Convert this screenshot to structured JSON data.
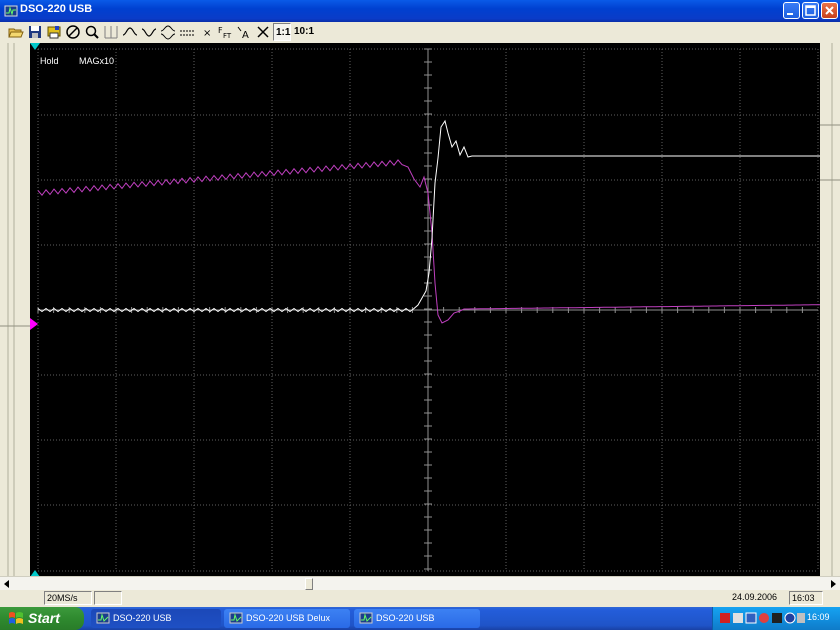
{
  "window": {
    "title": "DSO-220 USB"
  },
  "toolbar": {
    "buttons": [
      {
        "name": "open-folder-icon"
      },
      {
        "name": "save-disk-icon"
      },
      {
        "name": "print-icon"
      },
      {
        "name": "stop-icon"
      },
      {
        "name": "zoom-icon"
      },
      {
        "name": "grid-icon"
      },
      {
        "name": "wave-sine-icon"
      },
      {
        "name": "wave-invert-icon"
      },
      {
        "name": "wave-dual-icon"
      },
      {
        "name": "dotted-line-icon"
      },
      {
        "name": "marker-icon"
      },
      {
        "name": "fft-icon"
      },
      {
        "name": "auto-icon"
      },
      {
        "name": "cursor-icon"
      }
    ],
    "ratio_1_1": "1:1",
    "ratio_10_1": "10:1"
  },
  "scope": {
    "hold_label": "Hold",
    "mag_label": "MAGx10",
    "colors": {
      "ch1": "#ffffff",
      "ch2": "#c040c0",
      "grid": "#606060",
      "marker": "#ff00ff",
      "trigger": "#00c8c8"
    }
  },
  "status": {
    "rate": "20MS/s",
    "date": "24.09.2006",
    "time": "16:03"
  },
  "taskbar": {
    "start": "Start",
    "tasks": [
      {
        "label": "DSO-220 USB",
        "active": true
      },
      {
        "label": "DSO-220 USB Delux",
        "active": false
      },
      {
        "label": "DSO-220 USB",
        "active": false
      }
    ],
    "clock": "16:09"
  }
}
